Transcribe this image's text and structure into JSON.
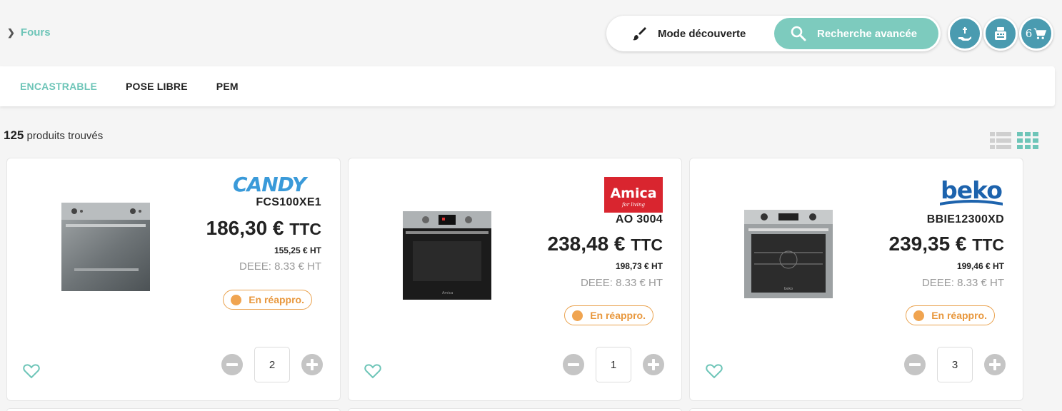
{
  "breadcrumb": {
    "label": "Fours"
  },
  "mode": {
    "discovery_label": "Mode découverte",
    "advanced_label": "Recherche avancée"
  },
  "header_buttons": {
    "cart_count": "6"
  },
  "tabs": [
    {
      "label": "ENCASTRABLE",
      "active": true
    },
    {
      "label": "POSE LIBRE",
      "active": false
    },
    {
      "label": "PEM",
      "active": false
    }
  ],
  "results": {
    "count": "125",
    "label": "produits trouvés"
  },
  "products": [
    {
      "brand": "CANDY",
      "brand_color": "#3a9ad9",
      "ref": "FCS100XE1",
      "price": "186,30 €",
      "price_suffix": "TTC",
      "price_ht": "155,25 € HT",
      "deee": "DEEE: 8.33 € HT",
      "stock": "En réappro.",
      "qty": "2"
    },
    {
      "brand": "Amica",
      "brand_tagline": "for living",
      "brand_color": "#d9252f",
      "ref": "AO 3004",
      "price": "238,48 €",
      "price_suffix": "TTC",
      "price_ht": "198,73 € HT",
      "deee": "DEEE: 8.33 € HT",
      "stock": "En réappro.",
      "qty": "1"
    },
    {
      "brand": "beko",
      "brand_color": "#1d63ad",
      "ref": "BBIE12300XD",
      "price": "239,35 €",
      "price_suffix": "TTC",
      "price_ht": "199,46 € HT",
      "deee": "DEEE: 8.33 € HT",
      "stock": "En réappro.",
      "qty": "3"
    }
  ],
  "colors": {
    "accent": "#6ec5b8",
    "button_blue": "#4a9bb0",
    "stock_orange": "#e8973c"
  }
}
